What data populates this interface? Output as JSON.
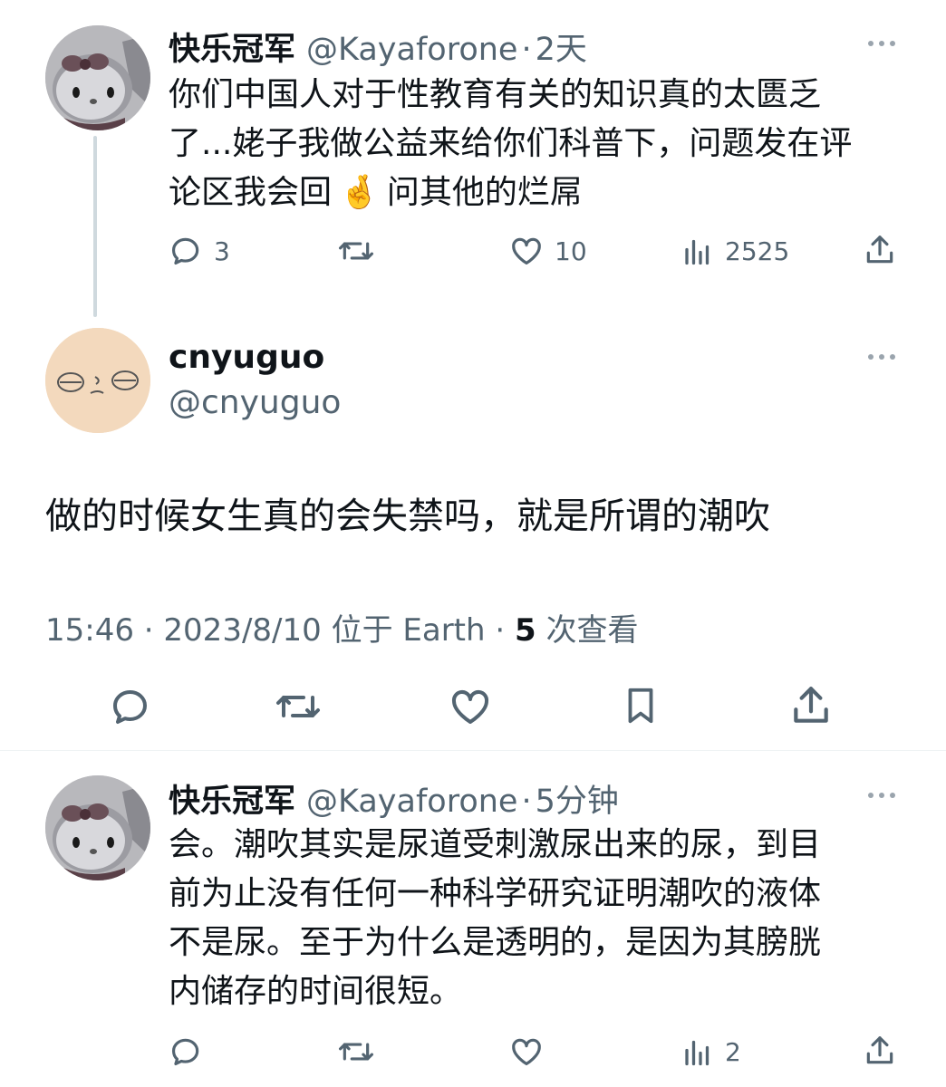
{
  "colors": {
    "text_primary": "#0f1419",
    "text_secondary": "#536471",
    "divider": "#eff3f4",
    "thread_line": "#cfd9de"
  },
  "post1": {
    "author_name": "快乐冠军",
    "author_handle": "@Kayaforone",
    "separator": "·",
    "time": "2天",
    "body_line1": "你们中国人对于性教育有关的知识真的太匮乏",
    "body_line2": "了...姥子我做公益来给你们科普下，问题发在评",
    "body_line3_a": "论区我会回",
    "body_emoji": "🤞",
    "body_line3_b": "问其他的烂屌",
    "reply_count": "3",
    "like_count": "10",
    "view_count": "2525",
    "icons": [
      "more-icon",
      "reply-icon",
      "retweet-icon",
      "like-icon",
      "views-icon",
      "share-icon"
    ]
  },
  "main_post": {
    "author_name": "cnyuguo",
    "author_handle": "@cnyuguo",
    "text": "做的时候女生真的会失禁吗，就是所谓的潮吹",
    "time": "15:46",
    "sep1": "·",
    "date": "2023/8/10",
    "location": "位于 Earth",
    "sep2": "·",
    "views_num": "5",
    "views_label": "次查看",
    "icons": [
      "more-icon",
      "reply-icon",
      "retweet-icon",
      "like-icon",
      "bookmark-icon",
      "share-icon"
    ]
  },
  "reply": {
    "author_name": "快乐冠军",
    "author_handle": "@Kayaforone",
    "separator": "·",
    "time": "5分钟",
    "body_line1": "会。潮吹其实是尿道受刺激尿出来的尿，到目",
    "body_line2": "前为止没有任何一种科学研究证明潮吹的液体",
    "body_line3": "不是尿。至于为什么是透明的，是因为其膀胱",
    "body_line4": "内储存的时间很短。",
    "view_count": "2",
    "icons": [
      "more-icon",
      "reply-icon",
      "retweet-icon",
      "like-icon",
      "views-icon",
      "share-icon"
    ]
  }
}
